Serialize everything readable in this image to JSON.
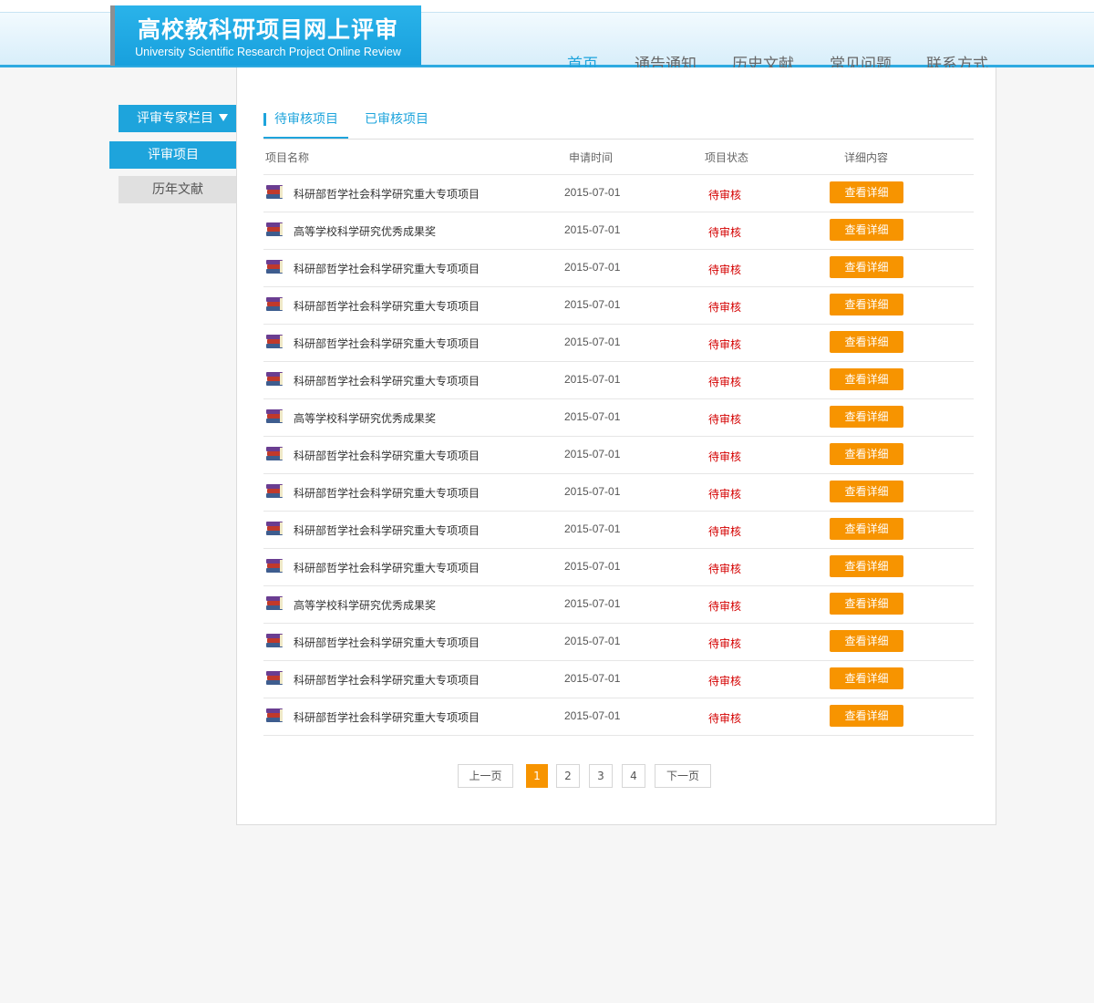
{
  "header": {
    "title": "高校教科研项目网上评审",
    "subtitle": "University Scientific Research Project Online Review",
    "nav": [
      {
        "label": "首页",
        "active": true
      },
      {
        "label": "通告通知"
      },
      {
        "label": "历史文献"
      },
      {
        "label": "常见问题"
      },
      {
        "label": "联系方式"
      }
    ]
  },
  "sidebar": {
    "heading": "评审专家栏目",
    "items": [
      {
        "label": "评审项目",
        "active": true
      },
      {
        "label": "历年文献"
      }
    ]
  },
  "main": {
    "tabs": [
      {
        "label": "待审核项目",
        "active": true
      },
      {
        "label": "已审核项目"
      }
    ],
    "columns": [
      "项目名称",
      "申请时间",
      "项目状态",
      "详细内容"
    ],
    "rows": [
      {
        "name": "科研部哲学社会科学研究重大专项项目",
        "date": "2015-07-01",
        "status": "待审核",
        "action": "查看详细"
      },
      {
        "name": "高等学校科学研究优秀成果奖",
        "date": "2015-07-01",
        "status": "待审核",
        "action": "查看详细"
      },
      {
        "name": "科研部哲学社会科学研究重大专项项目",
        "date": "2015-07-01",
        "status": "待审核",
        "action": "查看详细"
      },
      {
        "name": "科研部哲学社会科学研究重大专项项目",
        "date": "2015-07-01",
        "status": "待审核",
        "action": "查看详细"
      },
      {
        "name": "科研部哲学社会科学研究重大专项项目",
        "date": "2015-07-01",
        "status": "待审核",
        "action": "查看详细"
      },
      {
        "name": "科研部哲学社会科学研究重大专项项目",
        "date": "2015-07-01",
        "status": "待审核",
        "action": "查看详细"
      },
      {
        "name": "高等学校科学研究优秀成果奖",
        "date": "2015-07-01",
        "status": "待审核",
        "action": "查看详细"
      },
      {
        "name": "科研部哲学社会科学研究重大专项项目",
        "date": "2015-07-01",
        "status": "待审核",
        "action": "查看详细"
      },
      {
        "name": "科研部哲学社会科学研究重大专项项目",
        "date": "2015-07-01",
        "status": "待审核",
        "action": "查看详细"
      },
      {
        "name": "科研部哲学社会科学研究重大专项项目",
        "date": "2015-07-01",
        "status": "待审核",
        "action": "查看详细"
      },
      {
        "name": "科研部哲学社会科学研究重大专项项目",
        "date": "2015-07-01",
        "status": "待审核",
        "action": "查看详细"
      },
      {
        "name": "高等学校科学研究优秀成果奖",
        "date": "2015-07-01",
        "status": "待审核",
        "action": "查看详细"
      },
      {
        "name": "科研部哲学社会科学研究重大专项项目",
        "date": "2015-07-01",
        "status": "待审核",
        "action": "查看详细"
      },
      {
        "name": "科研部哲学社会科学研究重大专项项目",
        "date": "2015-07-01",
        "status": "待审核",
        "action": "查看详细"
      },
      {
        "name": "科研部哲学社会科学研究重大专项项目",
        "date": "2015-07-01",
        "status": "待审核",
        "action": "查看详细"
      }
    ],
    "row_icon": "book-stack-icon"
  },
  "pager": {
    "prev": "上一页",
    "pages": [
      "1",
      "2",
      "3",
      "4"
    ],
    "current": "1",
    "next": "下一页"
  },
  "colors": {
    "accent": "#1ea4dc",
    "button": "#f79400",
    "status": "#d40000"
  }
}
